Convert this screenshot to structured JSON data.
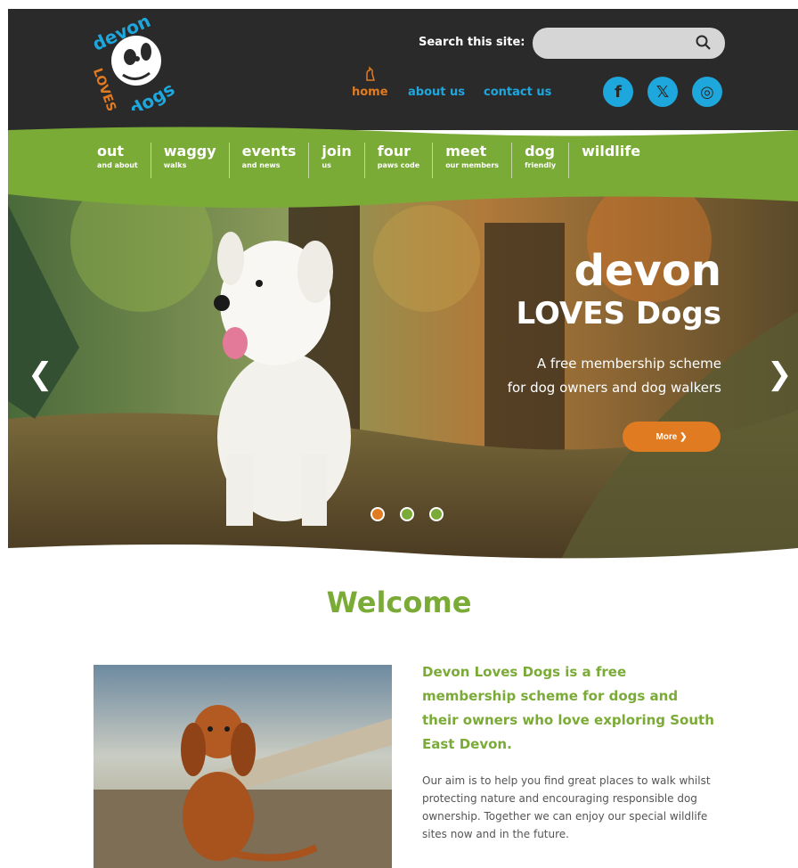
{
  "header": {
    "logo_text_line1": "devon",
    "logo_text_line2": "LOVES",
    "logo_text_line3": "dogs",
    "search_label": "Search this site:",
    "search_placeholder": "",
    "nav": {
      "home": "home",
      "about": "about us",
      "contact": "contact us"
    },
    "social": {
      "facebook": "f",
      "x": "𝕏",
      "instagram": "◎"
    }
  },
  "menu": [
    {
      "main": "out",
      "sub": "and about"
    },
    {
      "main": "waggy",
      "sub": "walks"
    },
    {
      "main": "events",
      "sub": "and news"
    },
    {
      "main": "join",
      "sub": "us"
    },
    {
      "main": "four",
      "sub": "paws code"
    },
    {
      "main": "meet",
      "sub": "our members"
    },
    {
      "main": "dog",
      "sub": "friendly"
    },
    {
      "main": "wildlife",
      "sub": ""
    }
  ],
  "hero": {
    "title": "devon",
    "subtitle": "LOVES Dogs",
    "text1": "A free membership scheme",
    "text2": "for dog owners and dog walkers",
    "button": "More ❯",
    "prev": "❮",
    "next": "❯"
  },
  "welcome": {
    "heading": "Welcome",
    "lead": "Devon Loves Dogs is a free membership scheme for dogs and their owners who love exploring South East Devon.",
    "body": "Our aim is to help you find great places to walk whilst protecting nature and encouraging responsible dog ownership. Together we can enjoy our special wildlife sites now and in the future."
  },
  "colors": {
    "header_bg": "#2b2a2a",
    "green": "#7bab37",
    "orange": "#e07b21",
    "blue": "#1ea7dd"
  }
}
